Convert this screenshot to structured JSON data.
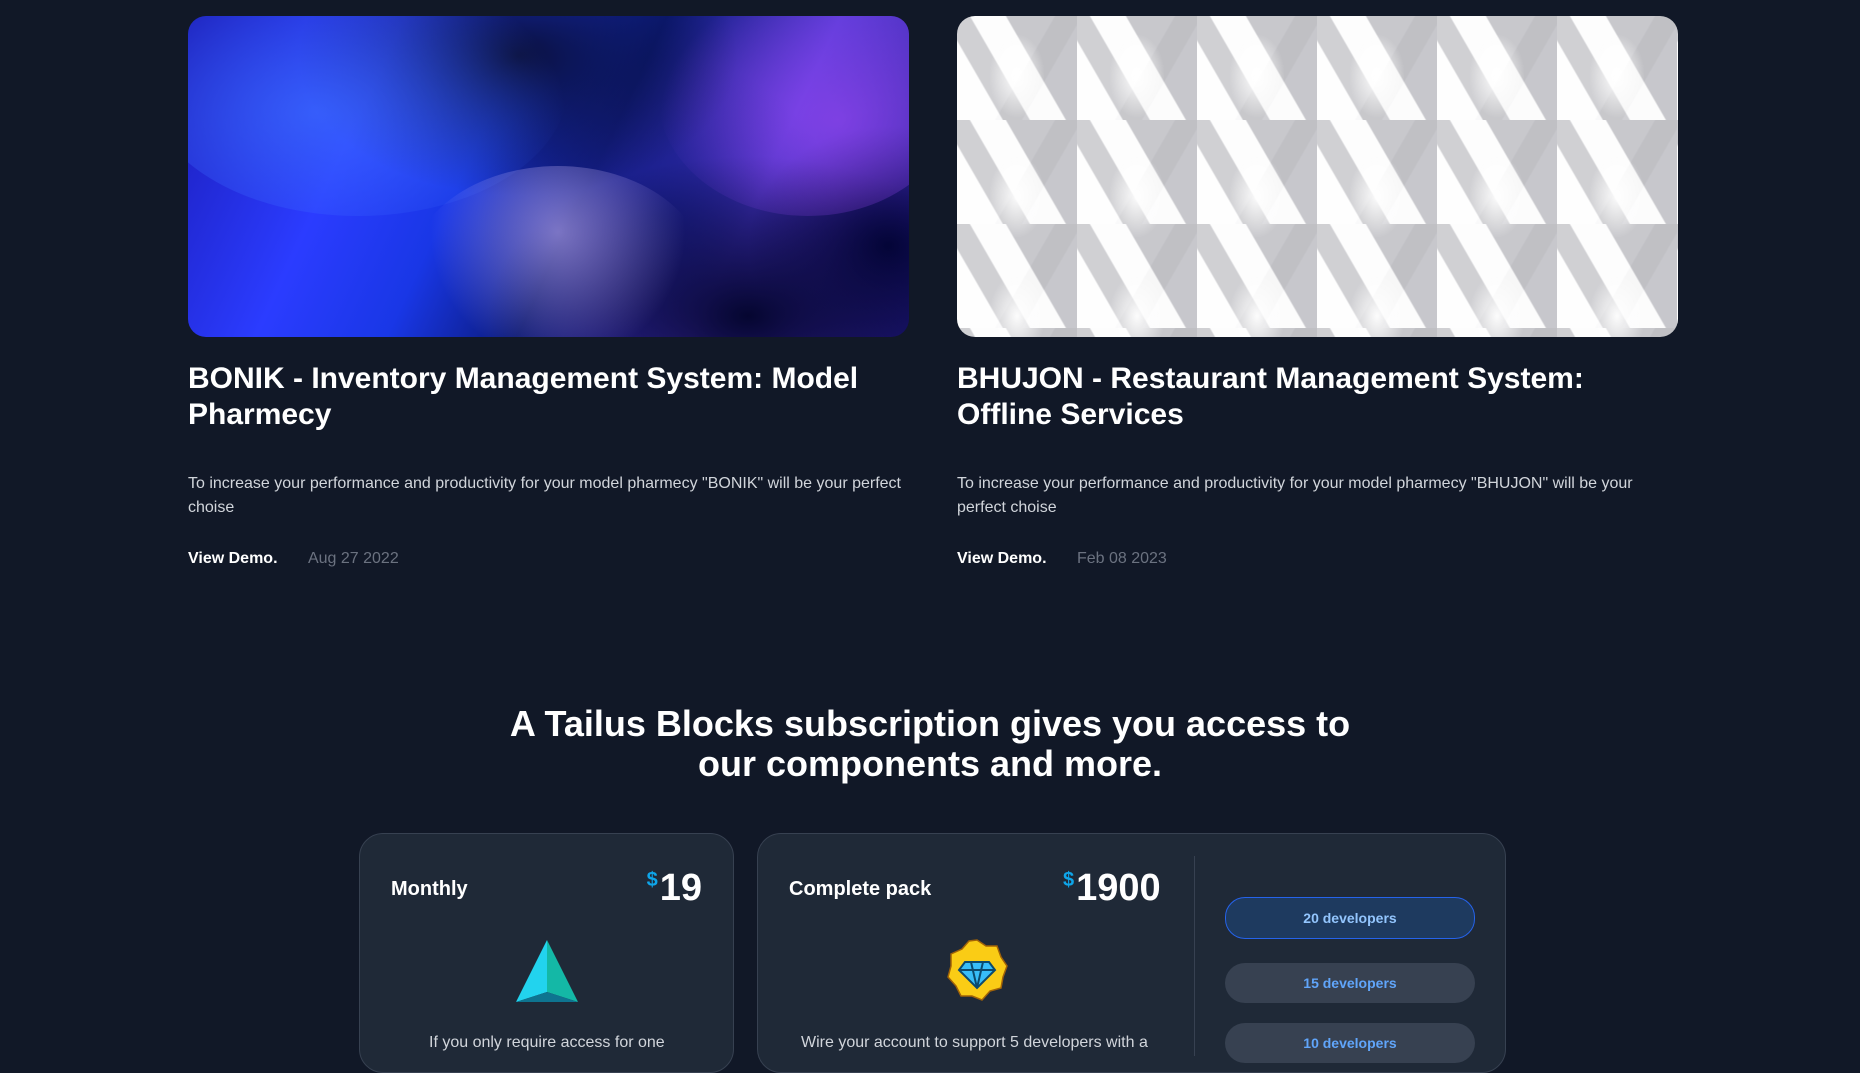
{
  "projects": [
    {
      "title": "BONIK - Inventory Management System: Model Pharmecy",
      "description": "To increase your performance and productivity for your model pharmecy \"BONIK\" will be your perfect choise",
      "link_label": "View Demo.",
      "date": "Aug 27 2022"
    },
    {
      "title": "BHUJON - Restaurant Management System: Offline Services",
      "description": "To increase your performance and productivity for your model pharmecy \"BHUJON\" will be your perfect choise",
      "link_label": "View Demo.",
      "date": "Feb 08 2023"
    }
  ],
  "pricing": {
    "heading_line1": "A Tailus Blocks subscription gives you access to",
    "heading_line2": "our components and more.",
    "monthly": {
      "name": "Monthly",
      "currency": "$",
      "price": "19",
      "description": "If you only require access for one"
    },
    "complete": {
      "name": "Complete pack",
      "currency": "$",
      "price": "1900",
      "description": "Wire your account to support 5 developers with a",
      "options": [
        "20 developers",
        "15 developers",
        "10 developers"
      ],
      "selected_option": "20 developers"
    }
  },
  "colors": {
    "background": "#111827",
    "card": "#1f2937",
    "accent": "#0ea5e9"
  }
}
